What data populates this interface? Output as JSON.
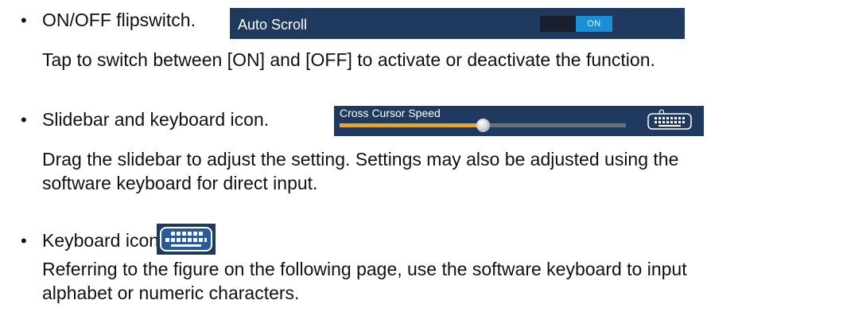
{
  "items": [
    {
      "title": "ON/OFF flipswitch.",
      "lines": [
        "Tap to switch between [ON] and [OFF] to activate or deactivate the function."
      ],
      "widget": {
        "label": "Auto Scroll",
        "switch_state": "ON",
        "switch_color": "#1a8fd6"
      }
    },
    {
      "title": "Slidebar and keyboard icon.",
      "lines": [
        "Drag the slidebar to adjust the setting. Settings may also be adjusted using the",
        "software keyboard for direct input."
      ],
      "widget": {
        "label": "Cross Cursor Speed",
        "value": "0",
        "slider_fraction": 0.5,
        "slider_fill_color": "#f2a516",
        "icon": "keyboard-icon"
      }
    },
    {
      "title": "Keyboard icon.",
      "lines": [
        "Referring to the figure on the following page, use the software keyboard to input",
        "alphabet or numeric characters."
      ],
      "widget": {
        "icon": "keyboard-icon"
      }
    }
  ],
  "colors": {
    "panel_background": "#1f3a5e",
    "keyboard_icon_border": "#ffffff"
  }
}
